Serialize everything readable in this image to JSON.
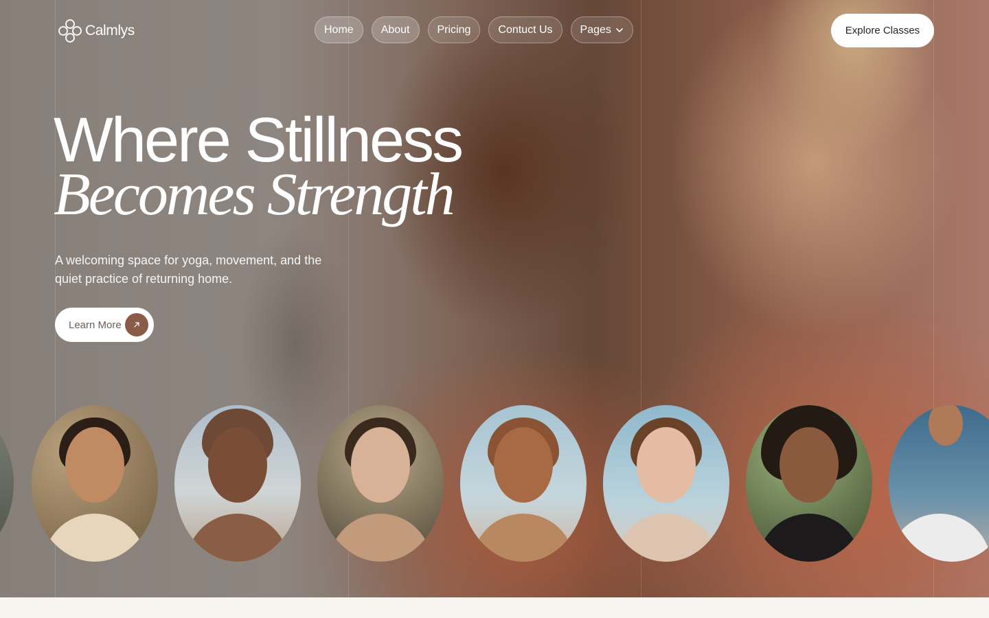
{
  "brand": {
    "name": "Calmlys"
  },
  "nav": {
    "items": [
      {
        "label": "Home",
        "active": true
      },
      {
        "label": "About",
        "active": true
      },
      {
        "label": "Pricing",
        "active": false
      },
      {
        "label": "Contuct Us",
        "active": false
      },
      {
        "label": "Pages",
        "active": false,
        "has_dropdown": true
      }
    ]
  },
  "header": {
    "cta_label": "Explore Classes"
  },
  "hero": {
    "headline_line1": "Where Stillness",
    "headline_line2": "Becomes Strength",
    "subtext": "A welcoming space for yoga, movement, and the quiet practice of returning home.",
    "button_label": "Learn More"
  },
  "portraits": [
    {
      "name": "portrait-partial-left"
    },
    {
      "name": "portrait-woman-fingers-temples"
    },
    {
      "name": "portrait-woman-hands-on-head-sky"
    },
    {
      "name": "portrait-woman-praying-hands"
    },
    {
      "name": "portrait-woman-arm-over-head"
    },
    {
      "name": "portrait-woman-profile-sky"
    },
    {
      "name": "portrait-woman-afro-garden"
    },
    {
      "name": "portrait-woman-meditating-partial"
    }
  ],
  "colors": {
    "accent": "#8a5c48",
    "page_background": "#f8f4f0",
    "button_text": "#2b2320"
  }
}
